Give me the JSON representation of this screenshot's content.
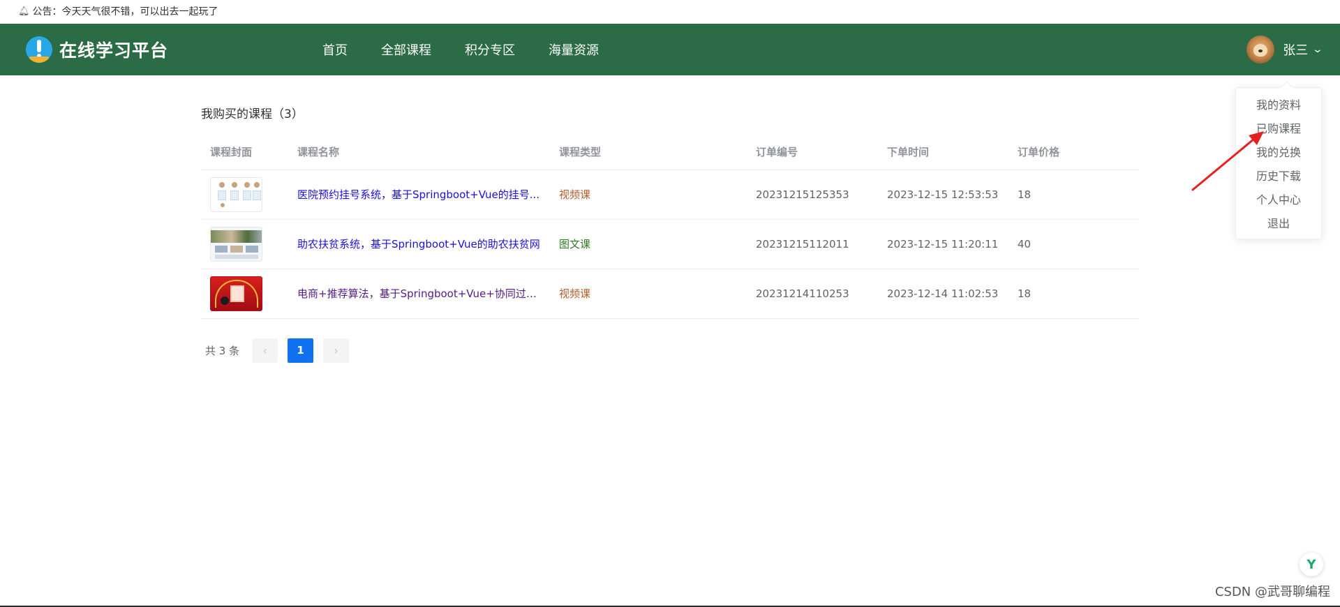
{
  "notice": {
    "bell_icon": "bell-icon",
    "text": "公告：今天天气很不错，可以出去一起玩了"
  },
  "header": {
    "logo_text": "在线学习平台",
    "nav": [
      "首页",
      "全部课程",
      "积分专区",
      "海量资源"
    ],
    "user_name": "张三",
    "chevron_icon": "chevron-down-icon",
    "bg_color": "#2b6b45"
  },
  "page": {
    "title": "我购买的课程（3）"
  },
  "table": {
    "headers": [
      "课程封面",
      "课程名称",
      "课程类型",
      "订单编号",
      "下单时间",
      "订单价格"
    ],
    "rows": [
      {
        "name": "医院预约挂号系统，基于Springboot+Vue的挂号...",
        "type": "视频课",
        "order": "20231215125353",
        "time": "2023-12-15 12:53:53",
        "price": "18"
      },
      {
        "name": "助农扶贫系统，基于Springboot+Vue的助农扶贫网",
        "type": "图文课",
        "order": "20231215112011",
        "time": "2023-12-15 11:20:11",
        "price": "40"
      },
      {
        "name": "电商+推荐算法，基于Springboot+Vue+协同过滤...",
        "type": "视频课",
        "order": "20231214110253",
        "time": "2023-12-14 11:02:53",
        "price": "18"
      }
    ]
  },
  "pagination": {
    "total": "共 3 条",
    "current": "1",
    "prev_icon": "chevron-left-icon",
    "next_icon": "chevron-right-icon"
  },
  "dropdown": {
    "items": [
      "我的资料",
      "已购课程",
      "我的兑换",
      "历史下载",
      "个人中心",
      "退出"
    ]
  },
  "watermark": "CSDN @武哥聊编程",
  "colors": {
    "accent": "#1072ee",
    "link": "#1b0fe0",
    "annotation_arrow": "#e62020"
  }
}
